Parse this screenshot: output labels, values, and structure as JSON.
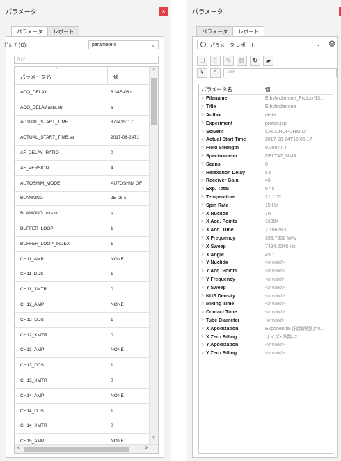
{
  "left": {
    "title": "パラメータ",
    "close_label": "×",
    "tabs": [
      "パラメータ",
      "レポート"
    ],
    "group_label": "ｸﾞﾙｰﾌﾟ(G):",
    "group_value": "parameters",
    "filter_placeholder": "ﾌｨﾙﾀ",
    "columns": [
      "パラメータ名",
      "値"
    ],
    "rows": [
      [
        "ACQ_DELAY",
        "8.34E-06 s"
      ],
      [
        "ACQ_DELAY.unts.str",
        "s"
      ],
      [
        "ACTUAL_START_TIME",
        "872435117"
      ],
      [
        "ACTUAL_START_TIME.str",
        "2017-08-24T1"
      ],
      [
        "AF_DELAY_RATIO",
        "0"
      ],
      [
        "AF_VERSION",
        "4"
      ],
      [
        "AUTOSHIM_MODE",
        "AUTOSHIM OF"
      ],
      [
        "BLANKING",
        "2E-06 s"
      ],
      [
        "BLANKING.unts.str",
        "s"
      ],
      [
        "BUFFER_LOOP",
        "1"
      ],
      [
        "BUFFER_LOOP_INDEX",
        "1"
      ],
      [
        "CH11_AMP",
        "NONE"
      ],
      [
        "CH11_DDS",
        "1"
      ],
      [
        "CH11_XMTR",
        "0"
      ],
      [
        "CH12_AMP",
        "NONE"
      ],
      [
        "CH12_DDS",
        "1"
      ],
      [
        "CH12_XMTR",
        "0"
      ],
      [
        "CH13_AMP",
        "NONE"
      ],
      [
        "CH13_DDS",
        "1"
      ],
      [
        "CH13_XMTR",
        "0"
      ],
      [
        "CH14_AMP",
        "NONE"
      ],
      [
        "CH14_DDS",
        "1"
      ],
      [
        "CH14_XMTR",
        "0"
      ],
      [
        "CH15_AMP",
        "NONE"
      ]
    ]
  },
  "right": {
    "title": "パラメータ",
    "tabs": [
      "パラメータ",
      "レポート"
    ],
    "report_select": "パラメータ レポート",
    "filter_placeholder": "ﾌｨﾙﾀ",
    "columns": [
      "パラメータ名",
      "値"
    ],
    "items": [
      [
        "Filename",
        "Ethylindanone_Proton-13...",
        false
      ],
      [
        "Title",
        "Ethylindanone",
        false
      ],
      [
        "Author",
        "delta",
        false
      ],
      [
        "Experiment",
        "proton.jxp",
        false
      ],
      [
        "Solvent",
        "CHLOROFORM-D",
        false
      ],
      [
        "Actual Start Time",
        "2017-08-24T16:05:17",
        false
      ],
      [
        "Field Strength",
        "9.38977 T",
        false
      ],
      [
        "Spectrometer",
        "DELTA2_NMR",
        false
      ],
      [
        "Scans",
        "8",
        false
      ],
      [
        "Relaxation Delay",
        "5 s",
        false
      ],
      [
        "Receiver Gain",
        "46",
        false
      ],
      [
        "Exp. Total",
        "67 s",
        false
      ],
      [
        "Temperature",
        "21.1 °C",
        false
      ],
      [
        "Spin Rate",
        "15 Hz",
        false
      ],
      [
        "X Nuclide",
        "1H",
        false
      ],
      [
        "X Acq. Points",
        "16384",
        false
      ],
      [
        "X Acq. Time",
        "2.18628 s",
        false
      ],
      [
        "X Frequency",
        "399.7802 MHz",
        false
      ],
      [
        "X Sweep",
        "7494.0048 Hz",
        false
      ],
      [
        "X Angle",
        "45 °",
        false
      ],
      [
        "Y Nuclide",
        "<invalid>",
        true
      ],
      [
        "Y Acq. Points",
        "<invalid>",
        true
      ],
      [
        "Y Frequency",
        "<invalid>",
        true
      ],
      [
        "Y Sweep",
        "<invalid>",
        true
      ],
      [
        "NUS Density",
        "<invalid>",
        true
      ],
      [
        "Mixing Time",
        "<invalid>",
        true
      ],
      [
        "Contact Time",
        "<invalid>",
        true
      ],
      [
        "Tube Diameter",
        "<invalid>",
        true
      ],
      [
        "X Apodization",
        "Exponential (指数関数)=0...",
        false
      ],
      [
        "X Zero Filling",
        "サイズ･係数=2",
        false
      ],
      [
        "Y Apodization",
        "<invalid>",
        true
      ],
      [
        "Y Zero Filling",
        "<invalid>",
        true
      ]
    ]
  },
  "colors": {
    "close": "#e0404a",
    "accent_border": "#c8c8c8"
  },
  "icons": [
    "close-icon",
    "chevron-down-icon",
    "gear-icon",
    "circle-report-icon",
    "expand-all-icon",
    "collapse-all-icon"
  ]
}
